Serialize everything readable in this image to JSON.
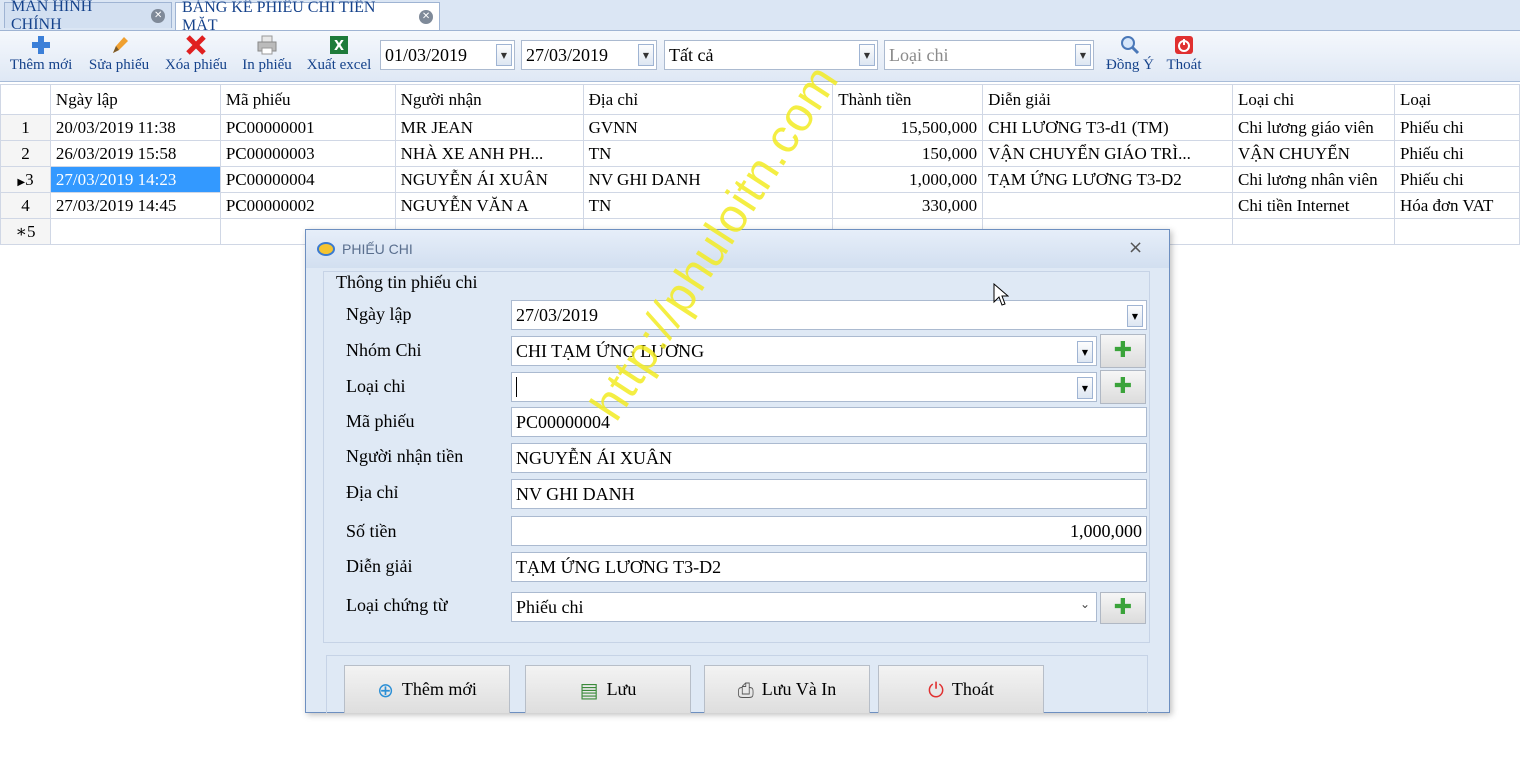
{
  "tabs": [
    {
      "label": "MÀN HÌNH CHÍNH"
    },
    {
      "label": "BẢNG KÊ PHIẾU CHI TIỀN MẶT"
    }
  ],
  "toolbar": {
    "add": "Thêm mới",
    "edit": "Sửa phiếu",
    "delete": "Xóa phiếu",
    "print": "In phiếu",
    "excel": "Xuất excel",
    "from_date": "01/03/2019",
    "to_date": "27/03/2019",
    "filter_all": "Tất cả",
    "type_placeholder": "Loại chi",
    "ok": "Đồng Ý",
    "exit": "Thoát"
  },
  "grid": {
    "columns": [
      "Ngày lập",
      "Mã phiếu",
      "Người nhận",
      "Địa chỉ",
      "Thành tiền",
      "Diễn giải",
      "Loại chi",
      "Loại"
    ],
    "rows": [
      {
        "no": "1",
        "date": "20/03/2019 11:38",
        "code": "PC00000001",
        "receiver": "MR JEAN",
        "address": "GVNN",
        "amount": "15,500,000",
        "desc": "CHI LƯƠNG T3-d1 (TM)",
        "type": "Chi lương giáo viên",
        "kind": "Phiếu chi"
      },
      {
        "no": "2",
        "date": "26/03/2019 15:58",
        "code": "PC00000003",
        "receiver": "NHÀ XE ANH PH...",
        "address": "TN",
        "amount": "150,000",
        "desc": "VẬN CHUYỂN GIÁO TRÌ...",
        "type": "VẬN CHUYỂN",
        "kind": "Phiếu chi"
      },
      {
        "no": "3",
        "date": "27/03/2019 14:23",
        "code": "PC00000004",
        "receiver": "NGUYỄN ÁI XUÂN",
        "address": "NV GHI DANH",
        "amount": "1,000,000",
        "desc": "TẠM ỨNG LƯƠNG T3-D2",
        "type": "Chi lương nhân viên",
        "kind": "Phiếu chi"
      },
      {
        "no": "4",
        "date": "27/03/2019 14:45",
        "code": "PC00000002",
        "receiver": "NGUYỄN VĂN A",
        "address": "TN",
        "amount": "330,000",
        "desc": "",
        "type": "Chi tiền Internet",
        "kind": "Hóa đơn VAT"
      }
    ],
    "new_row_no": "5",
    "selected_row": 3
  },
  "dialog": {
    "title": "PHIẾU CHI",
    "group_title": "Thông tin phiếu chi",
    "labels": {
      "date": "Ngày lập",
      "group": "Nhóm Chi",
      "type": "Loại chi",
      "code": "Mã phiếu",
      "receiver": "Người nhận tiền",
      "address": "Địa chỉ",
      "amount": "Số tiền",
      "desc": "Diễn giải",
      "doc_type": "Loại chứng từ"
    },
    "values": {
      "date": "27/03/2019",
      "group": "CHI TẠM ỨNG LƯƠNG",
      "type": "",
      "code": "PC00000004",
      "receiver": "NGUYỄN ÁI XUÂN",
      "address": "NV GHI DANH",
      "amount": "1,000,000",
      "desc": "TẠM ỨNG LƯƠNG T3-D2",
      "doc_type": "Phiếu chi"
    },
    "buttons": {
      "add": "Thêm mới",
      "save": "Lưu",
      "save_print": "Lưu Và In",
      "exit": "Thoát"
    }
  },
  "watermark": "http://phuloitn.com",
  "colors": {
    "selection": "#3399ff",
    "tab_text": "#15428b",
    "watermark": "#f3ec23",
    "add_green": "#3aa33a",
    "delete_red": "#e02020"
  }
}
